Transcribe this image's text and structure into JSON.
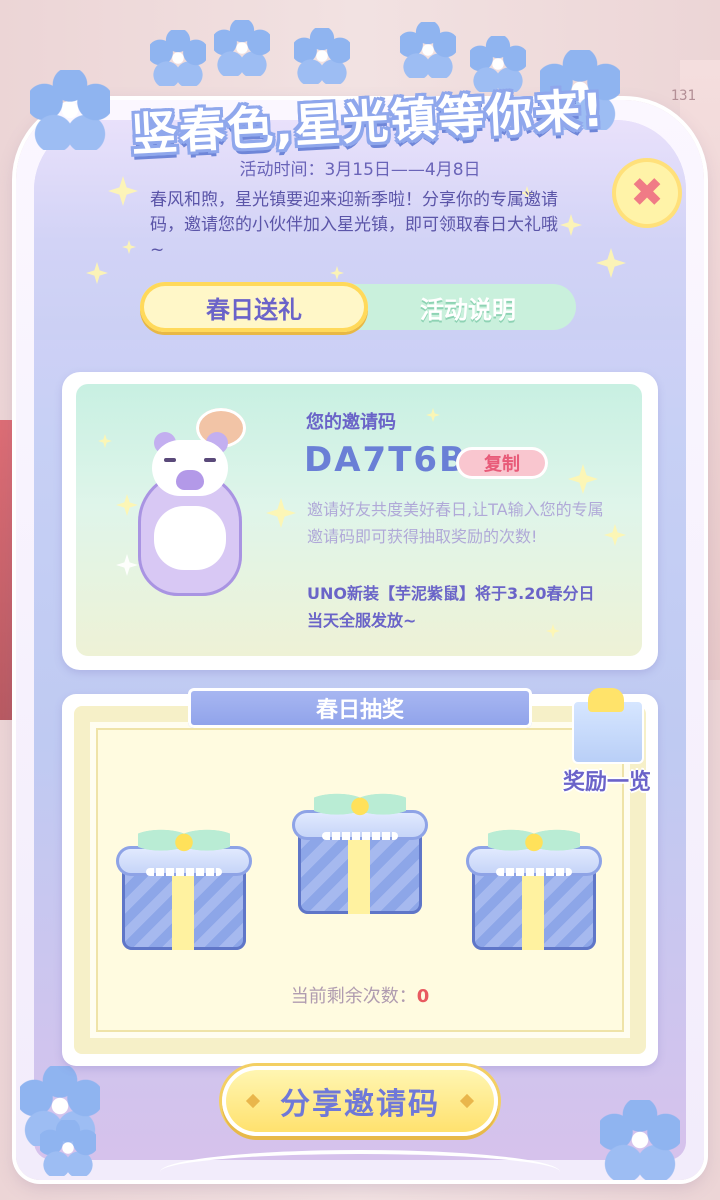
{
  "header": {
    "title": "竖春色,星光镇等你来!",
    "event_time": "活动时间：3月15日——4月8日",
    "intro": "春风和煦，星光镇要迎来迎新季啦！分享你的专属邀请码，邀请您的小伙伴加入星光镇，即可领取春日大礼哦~",
    "close_symbol": "✖"
  },
  "background": {
    "counter": "131"
  },
  "tabs": {
    "active": "春日送礼",
    "other": "活动说明"
  },
  "invite_card": {
    "label": "您的邀请码",
    "code": "DA7T6B",
    "copy_label": "复制",
    "description": "邀请好友共度美好春日,让TA输入您的专属邀请码即可获得抽取奖励的次数!",
    "uno_note": "UNO新装【芋泥紫鼠】将于3.20春分日当天全服发放~"
  },
  "lottery": {
    "title": "春日抽奖",
    "reward_list_label": "奖励一览",
    "remaining_label": "当前剩余次数：",
    "remaining_value": "0"
  },
  "share": {
    "label": "分享邀请码"
  },
  "colors": {
    "accent_purple": "#6b63c9",
    "tab_active_bg": "#fff7c8",
    "tab_inactive_bg": "#c9f0dc",
    "copy_button": "#f9c6cf",
    "share_button": "#ffe06a"
  }
}
